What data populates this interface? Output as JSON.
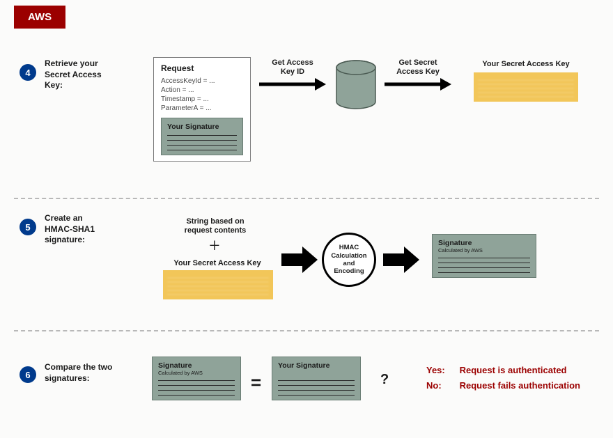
{
  "badge": "AWS",
  "steps": {
    "s4": {
      "num": "4",
      "title": "Retrieve your\nSecret Access\nKey:"
    },
    "s5": {
      "num": "5",
      "title": "Create an\nHMAC-SHA1\nsignature:"
    },
    "s6": {
      "num": "6",
      "title": "Compare the two\nsignatures:"
    }
  },
  "request": {
    "title": "Request",
    "lines": [
      "AccessKeyId = ...",
      "Action = ...",
      "Timestamp = ...",
      "ParameterA = ..."
    ],
    "sig_title": "Your Signature"
  },
  "arrow_labels": {
    "get_key_id": "Get Access\nKey ID",
    "get_secret": "Get Secret\nAccess Key"
  },
  "your_secret_label": "Your Secret Access Key",
  "step5": {
    "top_text": "String based on\nrequest contents",
    "bottom_text": "Your Secret Access Key",
    "hmac": "HMAC\nCalculation\nand\nEncoding",
    "sig_title": "Signature",
    "sig_sub": "Calculated by AWS"
  },
  "step6": {
    "sig1_title": "Signature",
    "sig1_sub": "Calculated by AWS",
    "sig2_title": "Your Signature",
    "yes_label": "Yes:",
    "yes_text": "Request is authenticated",
    "no_label": "No:",
    "no_text": "Request fails authentication"
  }
}
